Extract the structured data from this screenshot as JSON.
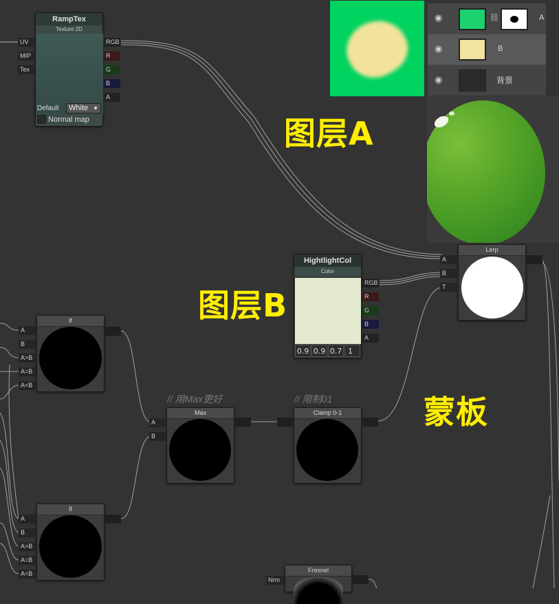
{
  "ramptex": {
    "title": "RampTex",
    "subtitle": "Texture 2D",
    "inputs": [
      "UV",
      "MIP",
      "Tex"
    ],
    "outputs": [
      "RGB",
      "R",
      "G",
      "B",
      "A"
    ],
    "default_label": "Default",
    "default_value": "White",
    "normal_map_label": "Normal map"
  },
  "hightlightcol": {
    "title": "HightlightCol",
    "subtitle": "Color",
    "swatch_color": "#e4ead0",
    "outputs": [
      "RGB",
      "R",
      "G",
      "B",
      "A"
    ],
    "values": [
      "0.9",
      "0.9",
      "0.7",
      "1"
    ]
  },
  "lerp": {
    "title": "Lerp",
    "inputs": [
      "A",
      "B",
      "T"
    ]
  },
  "if_top": {
    "title": "If",
    "inputs": [
      "A",
      "B",
      "A>B",
      "A=B",
      "A<B"
    ]
  },
  "if_bottom": {
    "title": "If",
    "inputs": [
      "A",
      "B",
      "A>B",
      "A=B",
      "A<B"
    ]
  },
  "max_node": {
    "title": "Max",
    "comment": "// 用Max更好",
    "inputs": [
      "A",
      "B"
    ]
  },
  "clamp_node": {
    "title": "Clamp 0-1",
    "comment": "// 限制01"
  },
  "fresnel": {
    "title": "Fresnel",
    "inputs": [
      "Nrm"
    ]
  },
  "labels": {
    "layer_a": "图层A",
    "layer_b": "图层B",
    "mask": "蒙板"
  },
  "layers_panel": {
    "rows": [
      {
        "name": "A",
        "visible": true,
        "thumb_color": "#1bd26e"
      },
      {
        "name": "B",
        "visible": true,
        "thumb_color": "#f1e3a0",
        "selected": true
      },
      {
        "name": "背景",
        "visible": true,
        "thumb_color": "#2b2b2b"
      }
    ]
  },
  "colors": {
    "canvas": "#333333",
    "label_yellow": "#ffee00",
    "layer_green": "#00d35f",
    "blob_cream": "#f3e29c",
    "wire": "#9a9a9a"
  }
}
